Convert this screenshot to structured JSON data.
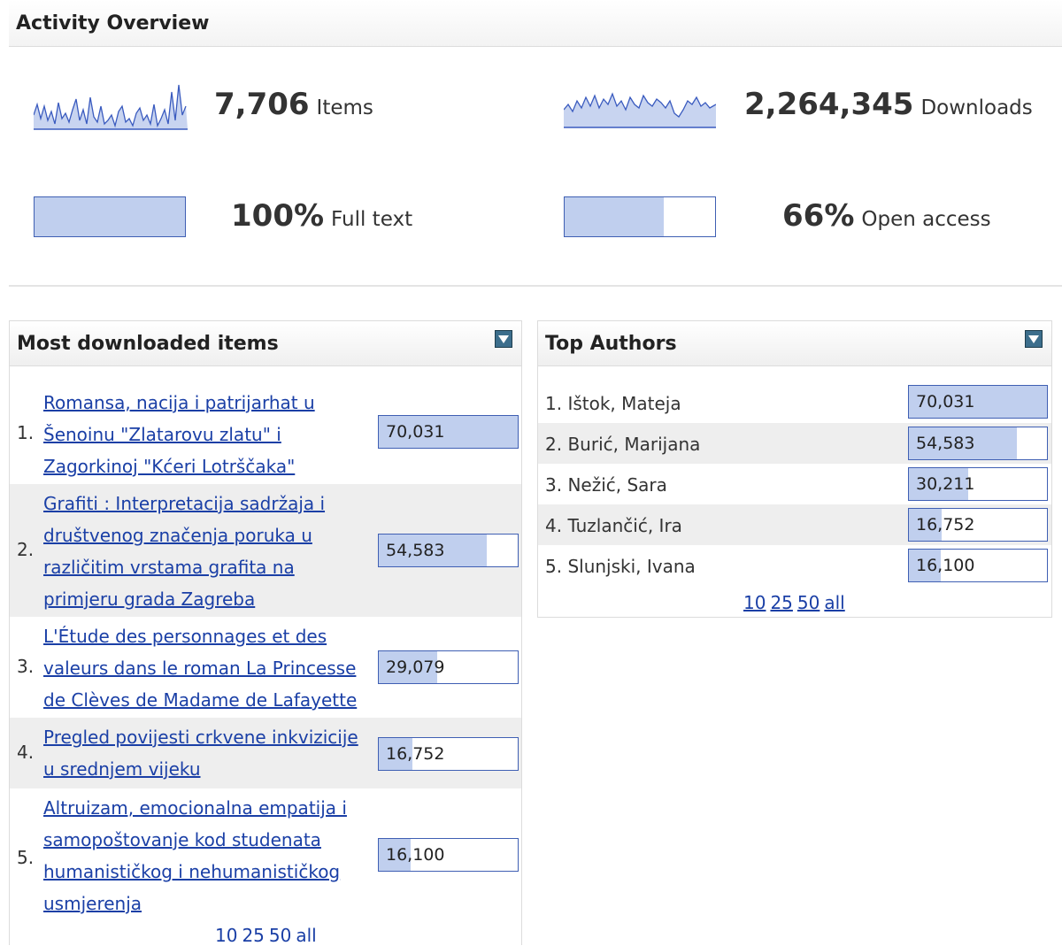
{
  "overview": {
    "title": "Activity Overview",
    "items": {
      "value": "7,706",
      "label": "Items"
    },
    "downloads": {
      "value": "2,264,345",
      "label": "Downloads"
    },
    "fulltext": {
      "value": "100%",
      "label": "Full text",
      "fraction": 1.0
    },
    "openaccess": {
      "value": "66%",
      "label": "Open access",
      "fraction": 0.66
    }
  },
  "most_downloaded": {
    "title": "Most downloaded items",
    "items": [
      {
        "rank": "1.",
        "title": "Romansa, nacija i patrijarhat u Šenoinu \"Zlatarovu zlatu\" i Zagorkinoj \"Kćeri Lotrščaka\"",
        "count": "70,031",
        "fraction": 1.0
      },
      {
        "rank": "2.",
        "title": "Grafiti : Interpretacija sadržaja i društvenog značenja poruka u različitim vrstama grafita na primjeru grada Zagreba",
        "count": "54,583",
        "fraction": 0.78
      },
      {
        "rank": "3.",
        "title": "L'Étude des personnages et des valeurs dans le roman La Princesse de Clèves de Madame de Lafayette",
        "count": "29,079",
        "fraction": 0.42
      },
      {
        "rank": "4.",
        "title": "Pregled povijesti crkvene inkvizicije u srednjem vijeku",
        "count": "16,752",
        "fraction": 0.24
      },
      {
        "rank": "5.",
        "title": "Altruizam, emocionalna empatija i samopoštovanje kod studenata humanističkog i nehumanističkog usmjerenja",
        "count": "16,100",
        "fraction": 0.23
      }
    ],
    "pager": [
      "10",
      "25",
      "50",
      "all"
    ]
  },
  "top_authors": {
    "title": "Top Authors",
    "items": [
      {
        "rank": "1.",
        "name": "Ištok, Mateja",
        "count": "70,031",
        "fraction": 1.0
      },
      {
        "rank": "2.",
        "name": "Burić, Marijana",
        "count": "54,583",
        "fraction": 0.78
      },
      {
        "rank": "3.",
        "name": "Nežić, Sara",
        "count": "30,211",
        "fraction": 0.43
      },
      {
        "rank": "4.",
        "name": "Tuzlančić, Ira",
        "count": "16,752",
        "fraction": 0.24
      },
      {
        "rank": "5.",
        "name": "Slunjski, Ivana",
        "count": "16,100",
        "fraction": 0.23
      }
    ],
    "pager": [
      "10",
      "25",
      "50",
      "all"
    ]
  },
  "colors": {
    "bar_fill": "#c0cfee",
    "bar_border": "#3f5fb3",
    "link": "#1a3fa6",
    "spark_line": "#3a5bbf",
    "spark_fill": "#c8d4f0"
  }
}
